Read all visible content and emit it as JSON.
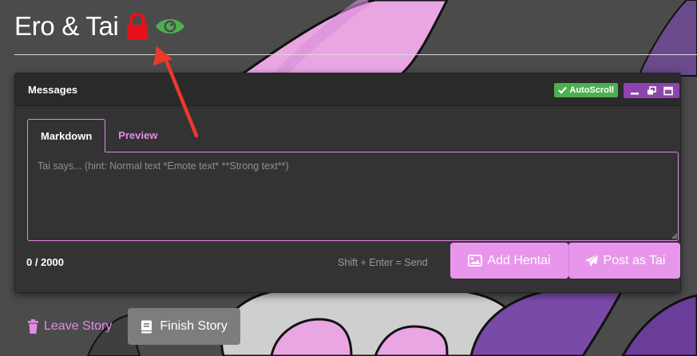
{
  "story": {
    "title": "Ero & Tai",
    "lock_icon": "lock-icon",
    "eye_icon": "eye-icon"
  },
  "messages_panel": {
    "title": "Messages",
    "autoscroll_label": "AutoScroll",
    "window_controls": [
      "minimize-icon",
      "restore-icon",
      "maximize-icon"
    ]
  },
  "editor": {
    "tabs": [
      {
        "label": "Markdown",
        "active": true
      },
      {
        "label": "Preview",
        "active": false
      }
    ],
    "placeholder": "Tai says... (hint: Normal text *Emote text* **Strong text**)",
    "char_count": "0 / 2000",
    "send_hint": "Shift + Enter = Send",
    "add_button_label": "Add Hentai",
    "post_button_label": "Post as Tai"
  },
  "actions": {
    "leave_label": "Leave Story",
    "finish_label": "Finish Story"
  },
  "colors": {
    "accent_pink": "#e896ec",
    "lock_red": "#e8101a",
    "eye_green": "#4caf50",
    "autoscroll_green": "#4caf50",
    "window_purple": "#8e44ad",
    "arrow_red": "#ea3a2b"
  }
}
